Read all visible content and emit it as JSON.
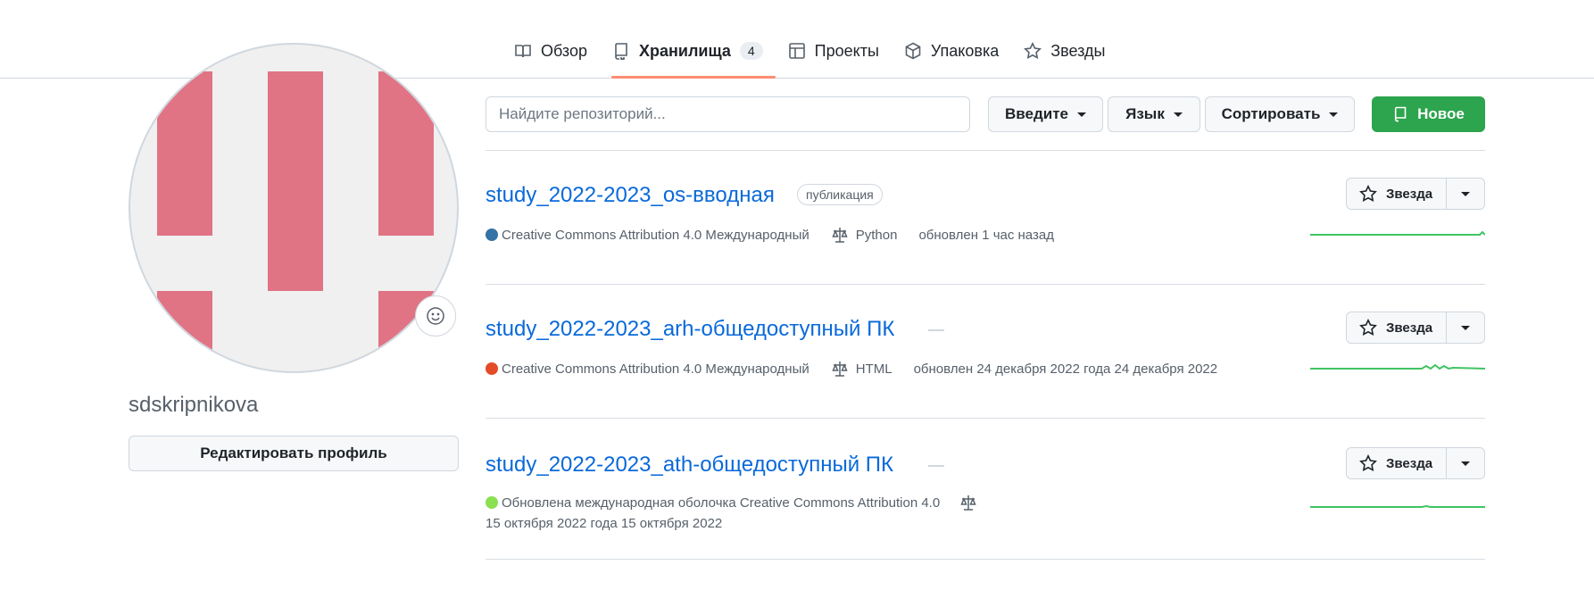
{
  "nav": {
    "tabs": [
      {
        "label": "Обзор",
        "icon": "book-icon"
      },
      {
        "label": "Хранилища",
        "icon": "repo-icon",
        "counter": "4",
        "selected": true
      },
      {
        "label": "Проекты",
        "icon": "table-icon"
      },
      {
        "label": "Упаковка",
        "icon": "package-icon"
      },
      {
        "label": "Звезды",
        "icon": "star-icon"
      }
    ]
  },
  "profile": {
    "username": "sdskripnikova",
    "edit_label": "Редактировать профиль",
    "avatar_color": "#e07485",
    "status_icon": "smiley-icon"
  },
  "filters": {
    "search_placeholder": "Найдите репозиторий...",
    "type_label": "Введите",
    "language_label": "Язык",
    "sort_label": "Сортировать",
    "new_label": "Новое",
    "new_color": "#2da44e"
  },
  "repos": [
    {
      "name": "study_2022-2023_os-вводная",
      "visibility": "публикация",
      "lang_color": "#3572A5",
      "license": "Creative Commons Attribution 4.0 Международный",
      "language": "Python",
      "updated": "обновлен 1 час назад",
      "star_label": "Звезда"
    },
    {
      "name": "study_2022-2023_arh-общедоступный ПК",
      "lang_color": "#e34c26",
      "license": "Creative Commons Attribution 4.0 Международный",
      "language": "HTML",
      "updated": "обновлен 24 декабря 2022 года 24 декабря 2022",
      "star_label": "Звезда"
    },
    {
      "name": "study_2022-2023_ath-общедоступный ПК",
      "lang_color": "#89e051",
      "license": "Обновлена международная оболочка Creative Commons Attribution 4.0",
      "updated": "15 октября 2022 года 15 октября 2022",
      "star_label": "Звезда"
    }
  ],
  "colors": {
    "link": "#0969da",
    "tab_underline": "#fd8c73",
    "sparkline": "#40c463"
  }
}
